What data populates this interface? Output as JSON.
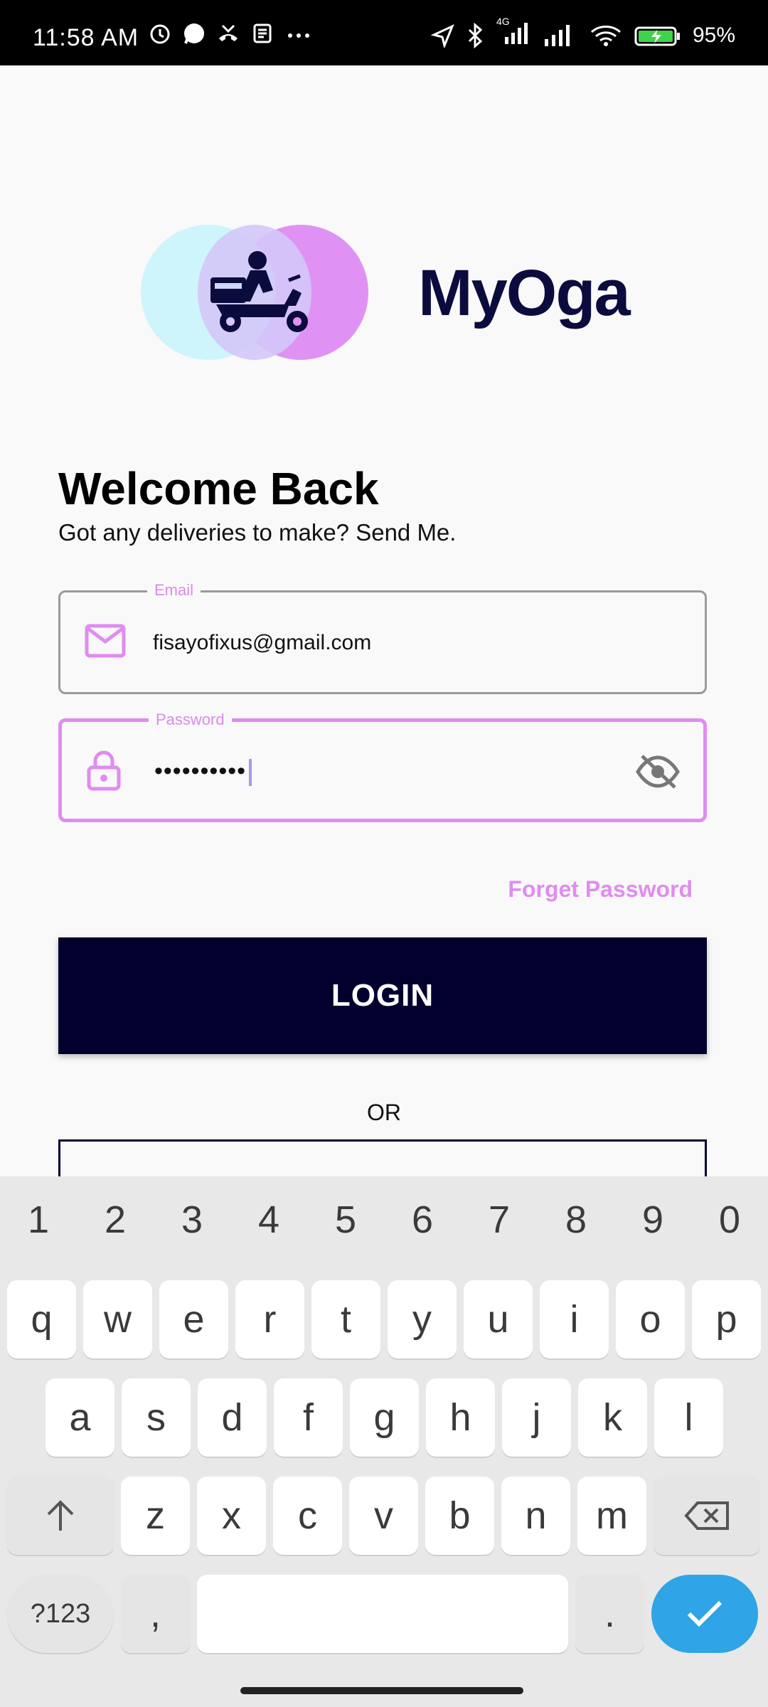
{
  "status_bar": {
    "time": "11:58 AM",
    "network_label": "4G",
    "battery": "95%",
    "left_icons": [
      "alarm-icon",
      "whatsapp-icon",
      "missed-call-icon",
      "news-icon",
      "more-dots-icon"
    ],
    "right_icons": [
      "location-arrow-icon",
      "bluetooth-icon",
      "signal-icon",
      "signal-icon",
      "wifi-icon",
      "battery-charging-icon"
    ]
  },
  "brand": {
    "name": "MyOga"
  },
  "header": {
    "title": "Welcome Back",
    "subtitle": "Got any deliveries to make? Send Me."
  },
  "form": {
    "email": {
      "label": "Email",
      "value": "fisayofixus@gmail.com"
    },
    "password": {
      "label": "Password",
      "value": "••••••••••"
    },
    "forget_password": "Forget Password",
    "login_label": "LOGIN",
    "or_label": "OR"
  },
  "colors": {
    "accent": "#e08cf0",
    "primary": "#02012e",
    "brand_text": "#0c0b3e",
    "keyboard_enter": "#2fa4e7"
  },
  "keyboard": {
    "numbers": [
      "1",
      "2",
      "3",
      "4",
      "5",
      "6",
      "7",
      "8",
      "9",
      "0"
    ],
    "row1": [
      "q",
      "w",
      "e",
      "r",
      "t",
      "y",
      "u",
      "i",
      "o",
      "p"
    ],
    "row2": [
      "a",
      "s",
      "d",
      "f",
      "g",
      "h",
      "j",
      "k",
      "l"
    ],
    "row3": [
      "z",
      "x",
      "c",
      "v",
      "b",
      "n",
      "m"
    ],
    "symbols_label": "?123",
    "comma_label": ",",
    "period_label": "."
  }
}
